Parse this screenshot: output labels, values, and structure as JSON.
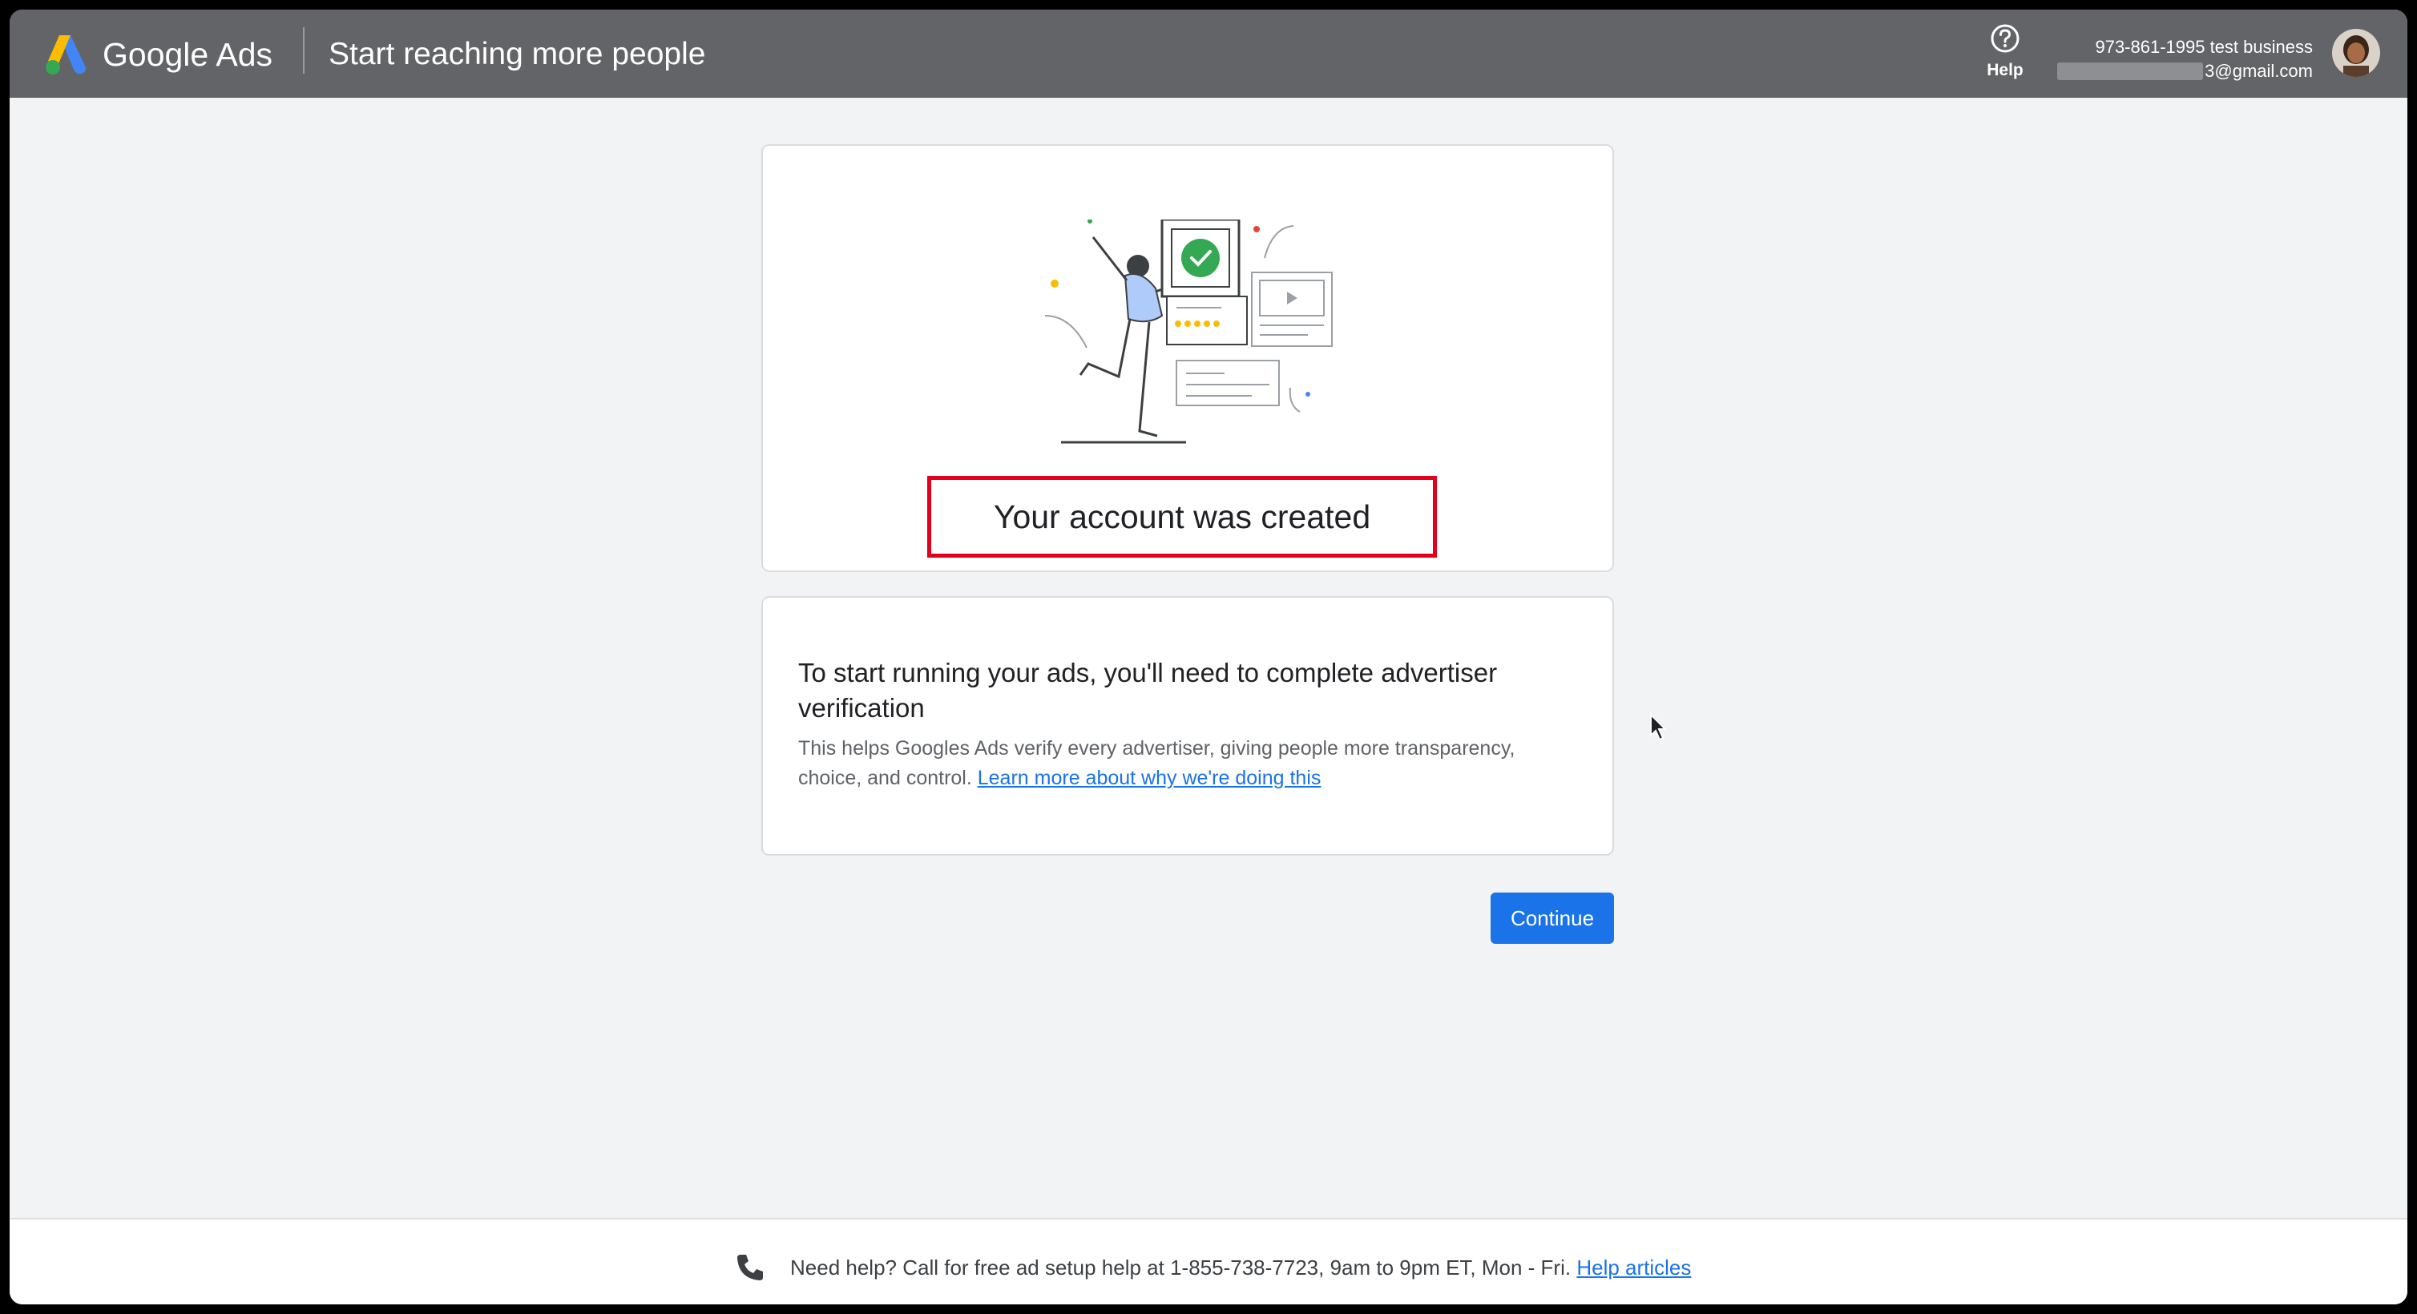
{
  "header": {
    "brand_google": "Google",
    "brand_ads": "Ads",
    "page_title": "Start reaching more people",
    "help_label": "Help",
    "account_name": "973-861-1995 test business",
    "account_email_visible": "3@gmail.com"
  },
  "created_card": {
    "title": "Your account was created"
  },
  "verify_card": {
    "heading": "To start running your ads, you'll need to complete advertiser verification",
    "text": "This helps Googles Ads verify every advertiser, giving people more transparency, choice, and control.",
    "link": "Learn more about why we're doing this"
  },
  "actions": {
    "continue_label": "Continue"
  },
  "footer": {
    "text": "Need help? Call for free ad setup help at 1-855-738-7723, 9am to 9pm ET, Mon - Fri.",
    "link": "Help articles"
  },
  "colors": {
    "header_bg": "#636467",
    "page_bg": "#f1f3f4",
    "primary_button": "#1a73e8",
    "highlight_box": "#e3001b",
    "success_green": "#34a853"
  },
  "icons": [
    "google-ads-logo-icon",
    "help-circle-icon",
    "phone-icon",
    "mouse-cursor-icon",
    "checkmark-icon"
  ]
}
